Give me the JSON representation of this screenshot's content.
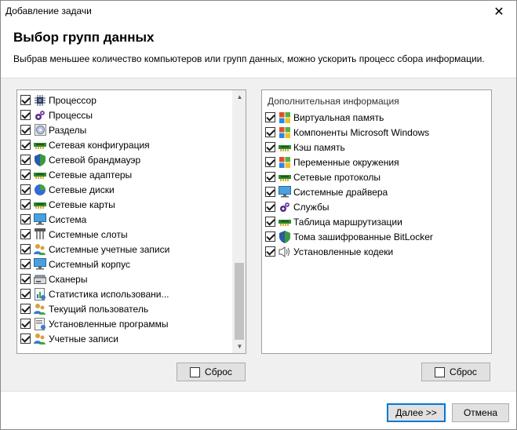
{
  "window": {
    "title": "Добавление задачи",
    "close_glyph": "✕"
  },
  "header": {
    "heading": "Выбор групп данных",
    "description": "Выбрав меньшее количество компьютеров или групп данных, можно ускорить процесс сбора информации."
  },
  "left_list": {
    "items": [
      {
        "label": "Процессор",
        "icon": "cpu-icon",
        "checked": true
      },
      {
        "label": "Процессы",
        "icon": "gears-icon",
        "checked": true
      },
      {
        "label": "Разделы",
        "icon": "disk-icon",
        "checked": true
      },
      {
        "label": "Сетевая конфигурация",
        "icon": "network-card-icon",
        "checked": true
      },
      {
        "label": "Сетевой брандмауэр",
        "icon": "shield-icon",
        "checked": true
      },
      {
        "label": "Сетевые адаптеры",
        "icon": "network-card-icon",
        "checked": true
      },
      {
        "label": "Сетевые диски",
        "icon": "pie-chart-icon",
        "checked": true
      },
      {
        "label": "Сетевые карты",
        "icon": "network-card-icon",
        "checked": true
      },
      {
        "label": "Система",
        "icon": "monitor-icon",
        "checked": true
      },
      {
        "label": "Системные слоты",
        "icon": "slot-icon",
        "checked": true
      },
      {
        "label": "Системные учетные записи",
        "icon": "users-icon",
        "checked": true
      },
      {
        "label": "Системный корпус",
        "icon": "monitor-icon",
        "checked": true
      },
      {
        "label": "Сканеры",
        "icon": "scanner-icon",
        "checked": true
      },
      {
        "label": "Статистика использовани...",
        "icon": "stats-icon",
        "checked": true
      },
      {
        "label": "Текущий пользователь",
        "icon": "users-icon",
        "checked": true
      },
      {
        "label": "Установленные программы",
        "icon": "programs-icon",
        "checked": true
      },
      {
        "label": "Учетные записи",
        "icon": "users-icon",
        "checked": true
      }
    ]
  },
  "right_list": {
    "header": "Дополнительная информация",
    "items": [
      {
        "label": "Виртуальная память",
        "icon": "windows-icon",
        "checked": true
      },
      {
        "label": "Компоненты Microsoft Windows",
        "icon": "windows-icon",
        "checked": true
      },
      {
        "label": "Кэш память",
        "icon": "network-card-icon",
        "checked": true
      },
      {
        "label": "Переменные окружения",
        "icon": "windows-icon",
        "checked": true
      },
      {
        "label": "Сетевые протоколы",
        "icon": "network-card-icon",
        "checked": true
      },
      {
        "label": "Системные драйвера",
        "icon": "monitor-icon",
        "checked": true
      },
      {
        "label": "Службы",
        "icon": "gears-icon",
        "checked": true
      },
      {
        "label": "Таблица маршрутизации",
        "icon": "network-card-icon",
        "checked": true
      },
      {
        "label": "Тома зашифрованные BitLocker",
        "icon": "shield-icon",
        "checked": true
      },
      {
        "label": "Установленные кодеки",
        "icon": "speaker-icon",
        "checked": true
      }
    ]
  },
  "buttons": {
    "reset_label": "Сброс",
    "next_label": "Далее >>",
    "cancel_label": "Отмена"
  },
  "scrollbar": {
    "up_glyph": "▲",
    "down_glyph": "▼"
  },
  "colors": {
    "accent": "#0078d7",
    "check_green": "#1e7a2e"
  }
}
